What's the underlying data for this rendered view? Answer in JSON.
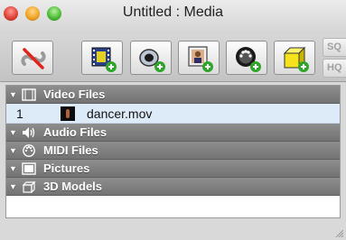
{
  "window": {
    "title": "Untitled : Media"
  },
  "toolbar": {
    "buttons": [
      {
        "name": "remove-media-button",
        "icon": "unlink-icon"
      },
      {
        "name": "add-video-button",
        "icon": "film-add-icon"
      },
      {
        "name": "add-audio-button",
        "icon": "speaker-add-icon"
      },
      {
        "name": "add-picture-button",
        "icon": "picture-add-icon"
      },
      {
        "name": "add-midi-button",
        "icon": "midi-add-icon"
      },
      {
        "name": "add-3d-model-button",
        "icon": "cube-add-icon"
      }
    ],
    "sq_label": "SQ",
    "hq_label": "HQ"
  },
  "media": {
    "groups": [
      {
        "label": "Video Files",
        "icon": "film-icon"
      },
      {
        "label": "Audio Files",
        "icon": "speaker-icon"
      },
      {
        "label": "MIDI Files",
        "icon": "midi-icon"
      },
      {
        "label": "Pictures",
        "icon": "picture-icon"
      },
      {
        "label": "3D Models",
        "icon": "cube-icon"
      }
    ],
    "video_items": [
      {
        "index": "1",
        "filename": "dancer.mov"
      }
    ]
  },
  "colors": {
    "group_header": "#808080",
    "selected_row": "#ddeaf8",
    "add_badge": "#2fa52a"
  }
}
